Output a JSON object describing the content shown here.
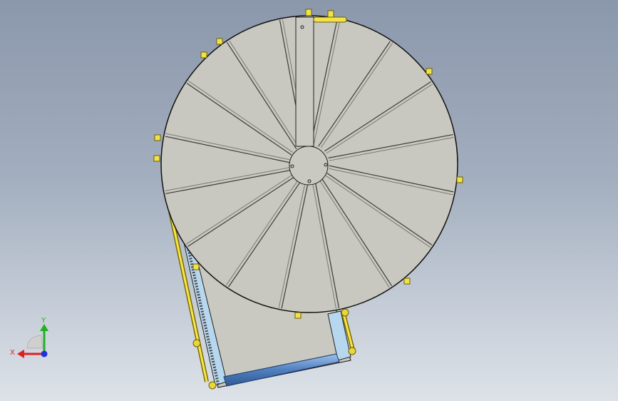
{
  "viewport": {
    "background_top": "#8b97ab",
    "background_bottom": "#dde2e8"
  },
  "model": {
    "disc_color": "#c8c8c0",
    "edge_color": "#111111",
    "blade_color": "#555555",
    "bracket_color": "#f0e040",
    "frame_color": "#b7d7ee",
    "tube_color": "#6b95c7",
    "rib_count": 16
  },
  "triad": {
    "x_label": "X",
    "y_label": "Y",
    "x_color": "#e02020",
    "y_color": "#20b020",
    "z_color": "#2030e0"
  }
}
